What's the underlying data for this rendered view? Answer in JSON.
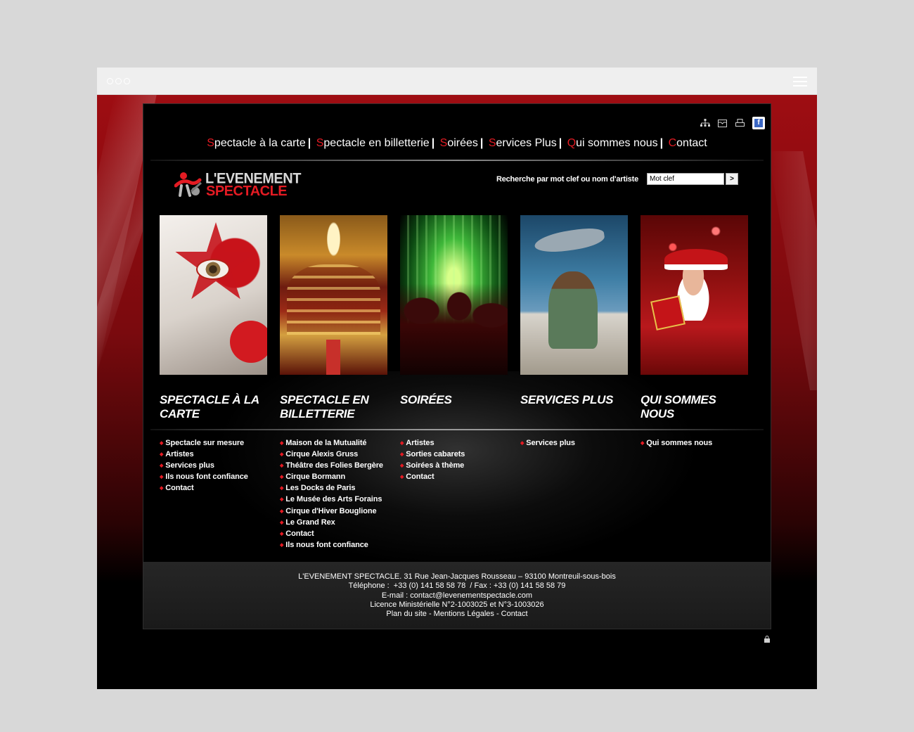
{
  "browser": {
    "window_controls": [
      "close",
      "minimize",
      "maximize"
    ],
    "menu_icon": "hamburger-icon"
  },
  "toolbar_icons": [
    "sitemap-icon",
    "mail-icon",
    "print-icon",
    "facebook-icon"
  ],
  "top_nav": [
    {
      "initial": "S",
      "rest": "pectacle à la carte"
    },
    {
      "initial": "S",
      "rest": "pectacle en billetterie"
    },
    {
      "initial": "S",
      "rest": "oirées"
    },
    {
      "initial": "S",
      "rest": "ervices Plus"
    },
    {
      "initial": "Q",
      "rest": "ui sommes nous"
    },
    {
      "initial": "C",
      "rest": "ontact"
    }
  ],
  "logo": {
    "line1": "L'EVENEMENT",
    "line2": "SPECTACLE"
  },
  "search": {
    "label": "Recherche par mot clef ou nom d'artiste",
    "value": "Mot clef",
    "button": ">"
  },
  "sections": [
    {
      "title": "SPECTACLE À LA CARTE",
      "links": [
        "Spectacle sur mesure",
        "Artistes",
        "Services plus",
        "Ils nous font confiance",
        "Contact"
      ]
    },
    {
      "title": "SPECTACLE EN BILLETTERIE",
      "links": [
        "Maison de la Mutualité",
        "Cirque Alexis Gruss",
        "Théâtre des Folies Bergère",
        "Cirque Bormann",
        "Les Docks de Paris",
        "Le Musée des Arts Forains",
        "Cirque d'Hiver Bouglione",
        "Le Grand Rex",
        "Contact",
        "Ils nous font confiance"
      ]
    },
    {
      "title": "SOIRÉES",
      "links": [
        "Artistes",
        "Sorties cabarets",
        "Soirées à thème",
        "Contact"
      ]
    },
    {
      "title": "SERVICES PLUS",
      "links": [
        "Services plus"
      ]
    },
    {
      "title": "QUI SOMMES NOUS",
      "links": [
        "Qui sommes nous"
      ]
    }
  ],
  "footer": {
    "address": "L'EVENEMENT SPECTACLE. 31 Rue Jean-Jacques Rousseau – 93100 Montreuil-sous-bois",
    "phone": "Téléphone :  +33 (0) 141 58 58 78  / Fax : +33 (0) 141 58 58 79",
    "email": "E-mail : contact@levenementspectacle.com",
    "licence": "Licence Ministérielle N°2-1003025 et N°3-1003026",
    "links": "Plan du site - Mentions Légales - Contact"
  },
  "colors": {
    "accent": "#e41b23",
    "background": "#000000",
    "frame": "#9e0d12"
  }
}
